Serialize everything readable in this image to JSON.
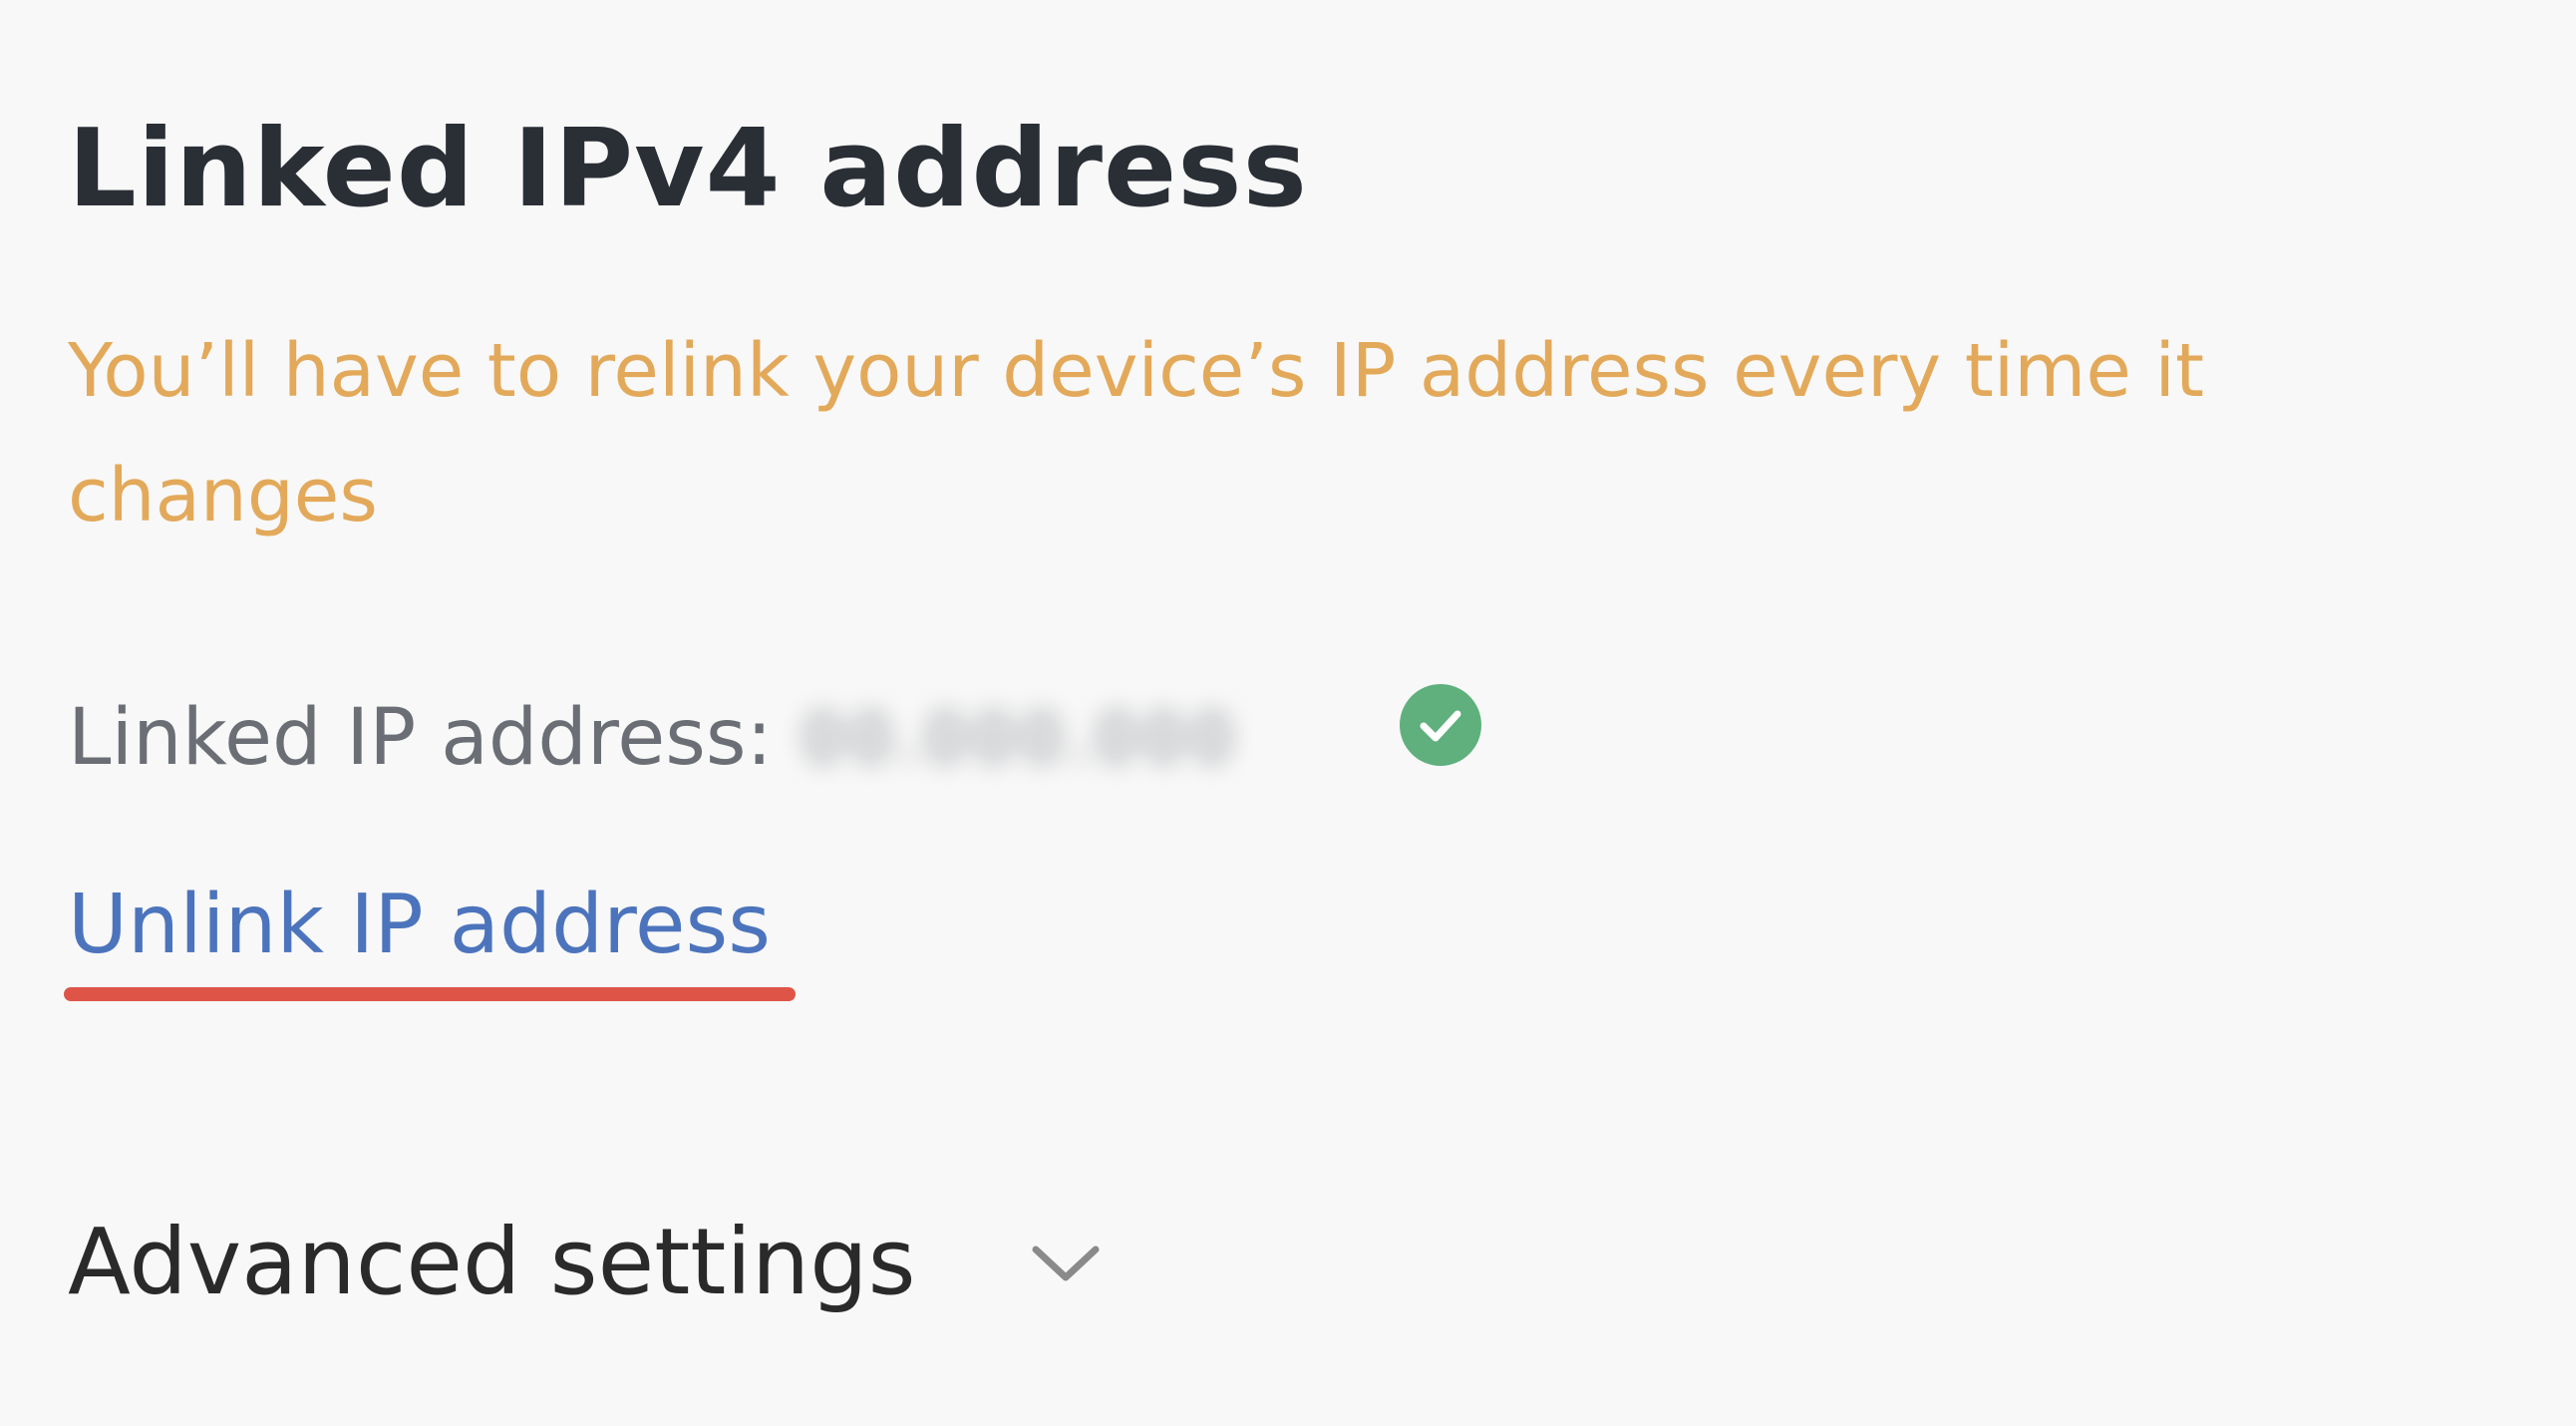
{
  "section": {
    "title": "Linked IPv4 address",
    "warning": "You’ll have to relink your device’s IP address every time it changes"
  },
  "linked": {
    "label": "Linked IP address:",
    "value": "00.000.000",
    "status_icon": "check-circle-icon",
    "status_color": "#5fb07d"
  },
  "actions": {
    "unlink_label": "Unlink IP address"
  },
  "advanced": {
    "label": "Advanced settings",
    "icon": "chevron-down-icon"
  },
  "colors": {
    "title": "#2a2f36",
    "warning": "#e3a95a",
    "link": "#4c74bd",
    "highlight": "#de5548"
  }
}
